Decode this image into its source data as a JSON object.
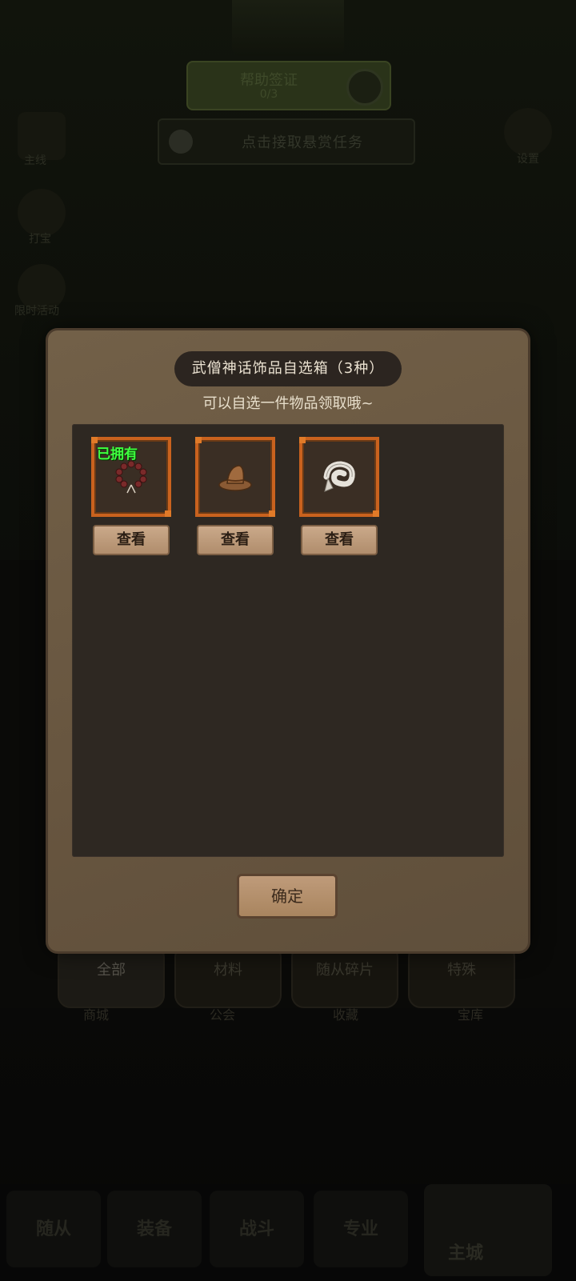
{
  "background": {
    "quest_title": "帮助签证",
    "quest_sub": "0/3",
    "bounty_text": "点击接取悬赏任务",
    "side_labels": [
      "主线",
      "打宝",
      "限时活动"
    ],
    "settings_label": "设置",
    "category_tabs": [
      "全部",
      "材料",
      "随从碎片",
      "特殊"
    ],
    "sub_labels": [
      "商城",
      "公会",
      "收藏",
      "宝库"
    ],
    "bottom_nav": [
      "随从",
      "装备",
      "战斗",
      "专业"
    ],
    "home_label": "主城"
  },
  "modal": {
    "title": "武僧神话饰品自选箱（3种）",
    "subtitle": "可以自选一件物品领取哦~",
    "items": [
      {
        "name": "prayer-beads",
        "owned_label": "已拥有",
        "view_label": "查看"
      },
      {
        "name": "leather-hat",
        "owned_label": "",
        "view_label": "查看"
      },
      {
        "name": "white-scarf",
        "owned_label": "",
        "view_label": "查看"
      }
    ],
    "confirm_label": "确定"
  },
  "colors": {
    "slot_border": "#c9621e",
    "owned_text": "#3fff3f",
    "modal_bg": "#6b5844"
  }
}
